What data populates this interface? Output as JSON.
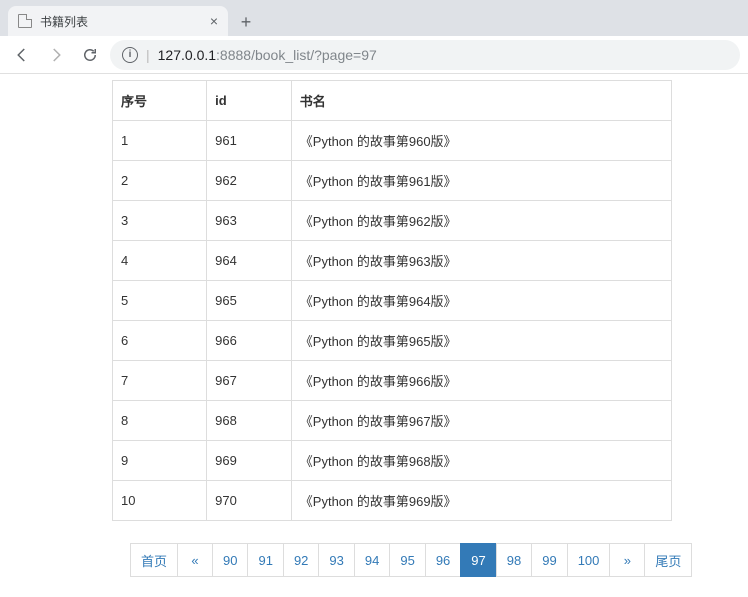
{
  "browser": {
    "tab_title": "书籍列表",
    "newtab": "+",
    "url_host": "127.0.0.1",
    "url_port": ":8888",
    "url_path": "/book_list/?page=97",
    "info_glyph": "i",
    "close_glyph": "×"
  },
  "table": {
    "headers": [
      "序号",
      "id",
      "书名"
    ],
    "rows": [
      {
        "seq": "1",
        "id": "961",
        "name": "《Python 的故事第960版》"
      },
      {
        "seq": "2",
        "id": "962",
        "name": "《Python 的故事第961版》"
      },
      {
        "seq": "3",
        "id": "963",
        "name": "《Python 的故事第962版》"
      },
      {
        "seq": "4",
        "id": "964",
        "name": "《Python 的故事第963版》"
      },
      {
        "seq": "5",
        "id": "965",
        "name": "《Python 的故事第964版》"
      },
      {
        "seq": "6",
        "id": "966",
        "name": "《Python 的故事第965版》"
      },
      {
        "seq": "7",
        "id": "967",
        "name": "《Python 的故事第966版》"
      },
      {
        "seq": "8",
        "id": "968",
        "name": "《Python 的故事第967版》"
      },
      {
        "seq": "9",
        "id": "969",
        "name": "《Python 的故事第968版》"
      },
      {
        "seq": "10",
        "id": "970",
        "name": "《Python 的故事第969版》"
      }
    ]
  },
  "pagination": {
    "items": [
      {
        "label": "首页",
        "active": false
      },
      {
        "label": "«",
        "active": false
      },
      {
        "label": "90",
        "active": false
      },
      {
        "label": "91",
        "active": false
      },
      {
        "label": "92",
        "active": false
      },
      {
        "label": "93",
        "active": false
      },
      {
        "label": "94",
        "active": false
      },
      {
        "label": "95",
        "active": false
      },
      {
        "label": "96",
        "active": false
      },
      {
        "label": "97",
        "active": true
      },
      {
        "label": "98",
        "active": false
      },
      {
        "label": "99",
        "active": false
      },
      {
        "label": "100",
        "active": false
      },
      {
        "label": "»",
        "active": false
      },
      {
        "label": "尾页",
        "active": false
      }
    ]
  }
}
